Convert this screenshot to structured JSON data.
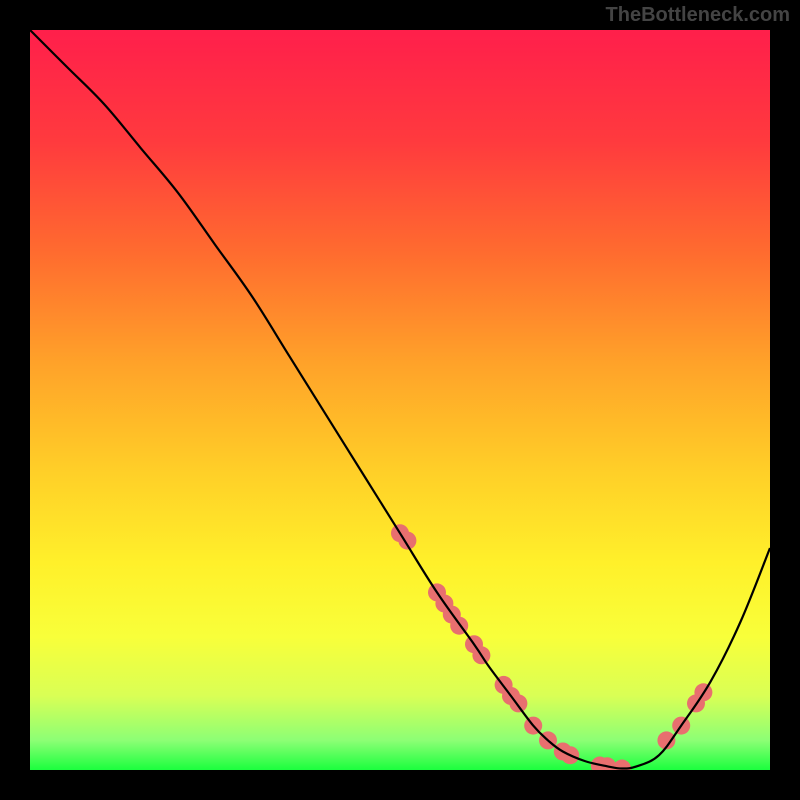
{
  "watermark": "TheBottleneck.com",
  "chart_data": {
    "type": "line",
    "title": "",
    "xlabel": "",
    "ylabel": "",
    "xlim": [
      0,
      100
    ],
    "ylim": [
      0,
      100
    ],
    "x": [
      0,
      5,
      10,
      15,
      20,
      25,
      30,
      35,
      40,
      45,
      50,
      55,
      60,
      62,
      65,
      68,
      70,
      72,
      75,
      78,
      80,
      82,
      85,
      88,
      92,
      96,
      100
    ],
    "y": [
      100,
      95,
      90,
      84,
      78,
      71,
      64,
      56,
      48,
      40,
      32,
      24,
      17,
      14,
      10,
      6,
      4,
      2.5,
      1.2,
      0.5,
      0.2,
      0.5,
      2,
      6,
      12,
      20,
      30
    ],
    "markers": {
      "x": [
        50,
        51,
        55,
        56,
        57,
        58,
        60,
        61,
        64,
        65,
        66,
        68,
        70,
        72,
        73,
        77,
        78,
        80,
        86,
        88,
        90,
        91
      ],
      "y": [
        32,
        31,
        24,
        22.5,
        21,
        19.5,
        17,
        15.5,
        11.5,
        10,
        9,
        6,
        4,
        2.5,
        2,
        0.6,
        0.5,
        0.2,
        4,
        6,
        9,
        10.5
      ]
    },
    "curve_color": "#000000",
    "marker_color": "#e86f6f",
    "marker_radius": 9,
    "gradient": {
      "stops": [
        {
          "offset": 0.0,
          "color": "#ff1f4b"
        },
        {
          "offset": 0.15,
          "color": "#ff3a3e"
        },
        {
          "offset": 0.3,
          "color": "#ff6b2f"
        },
        {
          "offset": 0.45,
          "color": "#ffa229"
        },
        {
          "offset": 0.6,
          "color": "#ffd028"
        },
        {
          "offset": 0.72,
          "color": "#fff02a"
        },
        {
          "offset": 0.82,
          "color": "#f8ff3a"
        },
        {
          "offset": 0.9,
          "color": "#d9ff55"
        },
        {
          "offset": 0.96,
          "color": "#8cff75"
        },
        {
          "offset": 1.0,
          "color": "#1bff3e"
        }
      ]
    }
  }
}
